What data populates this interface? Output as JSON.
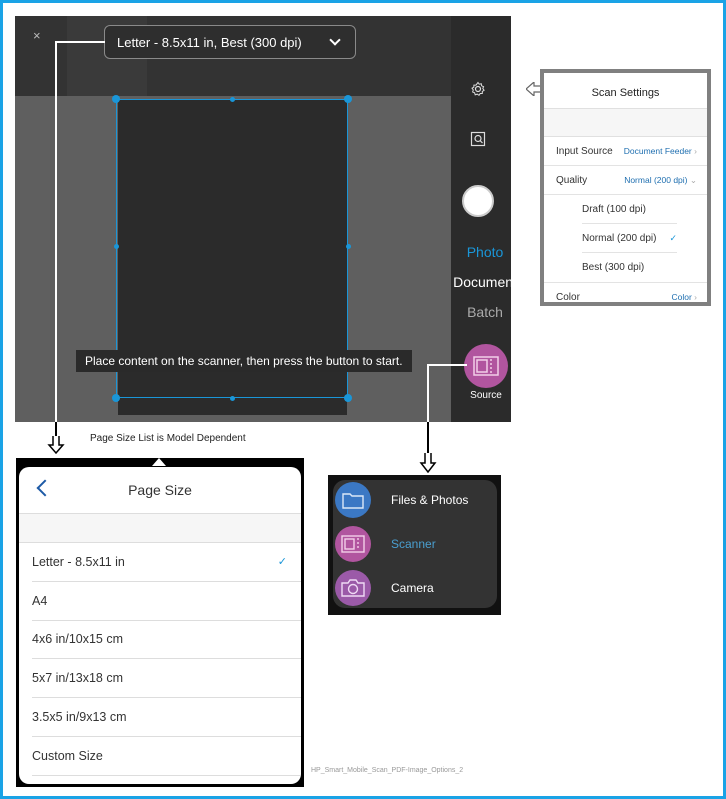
{
  "camera": {
    "close_label": "×",
    "page_select": "Letter - 8.5x11 in, Best (300 dpi)",
    "hint": "Place content on the scanner, then press the button to start.",
    "modes": [
      "Photo",
      "Document",
      "Batch"
    ],
    "active_mode": "Document",
    "source_label": "Source",
    "icons": [
      "gear-icon",
      "scan-preview-icon",
      "shutter-button",
      "source-icon"
    ]
  },
  "scan_settings": {
    "title": "Scan Settings",
    "rows": [
      {
        "label": "Input Source",
        "value": "Document Feeder"
      },
      {
        "label": "Quality",
        "value": "Normal (200 dpi)"
      }
    ],
    "quality_options": [
      {
        "label": "Draft (100 dpi)",
        "selected": false
      },
      {
        "label": "Normal (200 dpi)",
        "selected": true
      },
      {
        "label": "Best (300 dpi)",
        "selected": false
      }
    ],
    "color": {
      "label": "Color",
      "value": "Color"
    }
  },
  "page_size": {
    "caption": "Page Size List is Model Dependent",
    "title": "Page Size",
    "items": [
      {
        "label": "Letter - 8.5x11 in",
        "selected": true
      },
      {
        "label": "A4",
        "selected": false
      },
      {
        "label": "4x6 in/10x15 cm",
        "selected": false
      },
      {
        "label": "5x7 in/13x18 cm",
        "selected": false
      },
      {
        "label": "3.5x5 in/9x13 cm",
        "selected": false
      },
      {
        "label": "Custom Size",
        "selected": false
      }
    ]
  },
  "source_menu": {
    "items": [
      {
        "label": "Files & Photos",
        "color": "#3b78c4",
        "active": false
      },
      {
        "label": "Scanner",
        "color": "#b1559f",
        "active": true
      },
      {
        "label": "Camera",
        "color": "#9b5aa8",
        "active": false
      }
    ]
  },
  "colors": {
    "accent": "#1a96d8",
    "source": "#b1559f",
    "frame": "#1aa3e6"
  },
  "footnote": "HP_Smart_Mobile_Scan_PDF-Image_Options_2",
  "check_glyph": "✓"
}
